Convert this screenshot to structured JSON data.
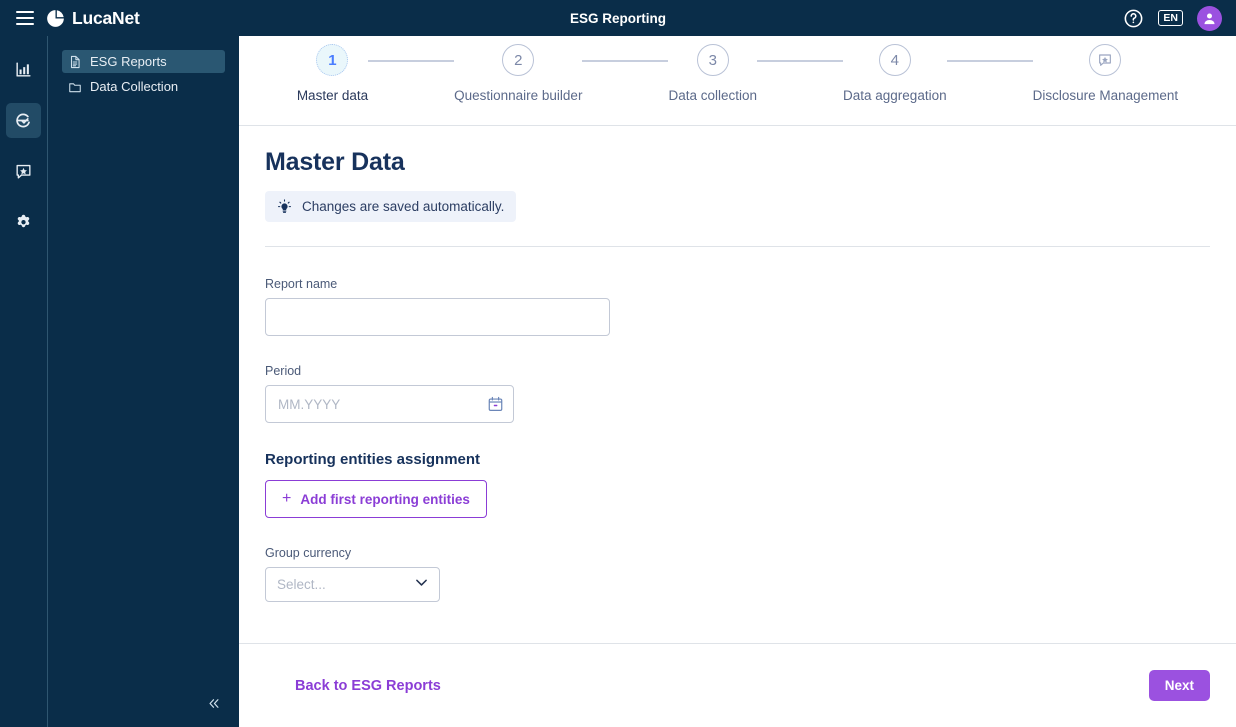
{
  "topbar": {
    "menu_icon": "hamburger-icon",
    "brand_name": "LucaNet",
    "title": "ESG Reporting",
    "help_icon": "help-circle-icon",
    "language": "EN",
    "avatar_icon": "user-avatar-icon"
  },
  "rail": {
    "items": [
      {
        "icon": "analytics-chart-icon",
        "name": "analytics",
        "active": false
      },
      {
        "icon": "esg-check-icon",
        "name": "esg-reporting",
        "active": true
      },
      {
        "icon": "disclosure-badge-icon",
        "name": "disclosure-management",
        "active": false
      },
      {
        "icon": "gear-icon",
        "name": "settings",
        "active": false
      }
    ]
  },
  "sidebar": {
    "items": [
      {
        "label": "ESG Reports",
        "icon": "document-icon",
        "selected": true
      },
      {
        "label": "Data Collection",
        "icon": "folder-icon",
        "selected": false
      }
    ],
    "collapse_icon": "double-chevron-left-icon"
  },
  "stepper": {
    "steps": [
      {
        "number": "1",
        "label": "Master data",
        "active": true
      },
      {
        "number": "2",
        "label": "Questionnaire builder",
        "active": false
      },
      {
        "number": "3",
        "label": "Data collection",
        "active": false
      },
      {
        "number": "4",
        "label": "Data aggregation",
        "active": false
      },
      {
        "number": "",
        "label": "Disclosure Management",
        "active": false,
        "icon": "disclosure-badge-icon"
      }
    ]
  },
  "page": {
    "title": "Master Data",
    "notice_icon": "lightbulb-icon",
    "notice_text": "Changes are saved automatically."
  },
  "form": {
    "report_name": {
      "label": "Report name",
      "value": "",
      "placeholder": ""
    },
    "period": {
      "label": "Period",
      "value": "",
      "placeholder": "MM.YYYY",
      "icon": "calendar-icon"
    },
    "entities": {
      "title": "Reporting entities assignment",
      "button_label": "Add first reporting entities",
      "button_icon": "plus-icon"
    },
    "group_currency": {
      "label": "Group currency",
      "value": "Select...",
      "caret_icon": "chevron-down-icon"
    }
  },
  "footer": {
    "back_label": "Back to ESG Reports",
    "next_label": "Next"
  },
  "colors": {
    "navy": "#0a2d49",
    "purple": "#9b51e0",
    "purple_dark": "#8b3dd6",
    "active_step_blue": "#4a7dff",
    "title_navy": "#17325c"
  }
}
